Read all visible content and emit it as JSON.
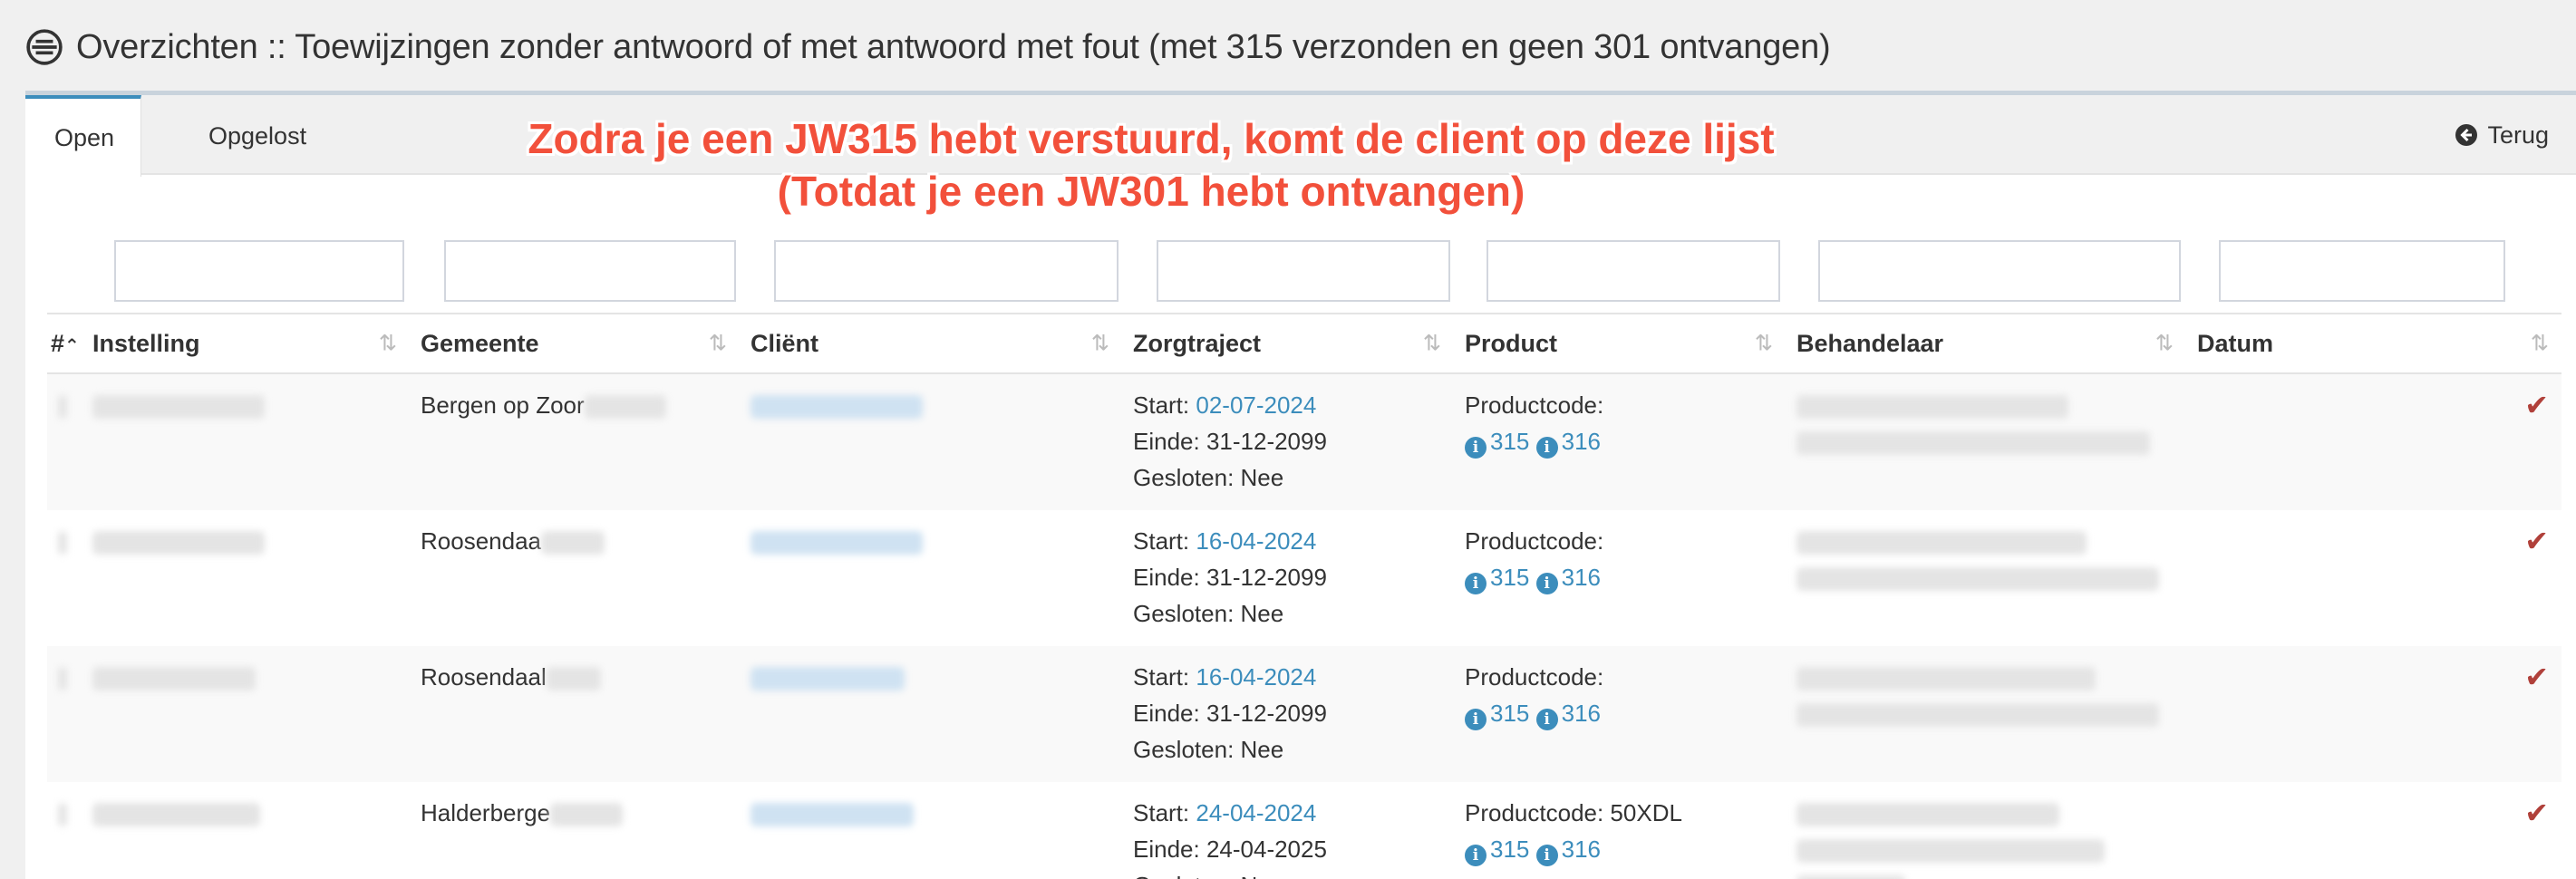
{
  "header": {
    "title": "Overzichten :: Toewijzingen zonder antwoord of met antwoord met fout (met 315 verzonden en geen 301 ontvangen)"
  },
  "tabs": [
    {
      "label": "Open",
      "active": true
    },
    {
      "label": "Opgelost",
      "active": false
    }
  ],
  "back_label": "Terug",
  "annotation": {
    "line1": "Zodra je een JW315 hebt verstuurd, komt de client op deze lijst",
    "line2": "(Totdat je een JW301 hebt ontvangen)"
  },
  "table": {
    "columns": [
      "#",
      "Instelling",
      "Gemeente",
      "Cliënt",
      "Zorgtraject",
      "Product",
      "Behandelaar",
      "Datum"
    ],
    "rows": [
      {
        "gemeente": "Bergen op Zoor",
        "start_label": "Start: ",
        "start": "02-07-2024",
        "einde": "Einde: 31-12-2099",
        "gesloten": "Gesloten: Nee",
        "productcode": "Productcode:",
        "p1": "315",
        "p2": "316"
      },
      {
        "gemeente": "Roosendaa",
        "start_label": "Start: ",
        "start": "16-04-2024",
        "einde": "Einde: 31-12-2099",
        "gesloten": "Gesloten: Nee",
        "productcode": "Productcode:",
        "p1": "315",
        "p2": "316"
      },
      {
        "gemeente": "Roosendaal",
        "start_label": "Start: ",
        "start": "16-04-2024",
        "einde": "Einde: 31-12-2099",
        "gesloten": "Gesloten: Nee",
        "productcode": "Productcode:",
        "p1": "315",
        "p2": "316"
      },
      {
        "gemeente": "Halderberge",
        "start_label": "Start: ",
        "start": "24-04-2024",
        "einde": "Einde: 24-04-2025",
        "gesloten": "Gesloten: Nee",
        "productcode": "Productcode: 50XDL",
        "p1": "315",
        "p2": "316"
      }
    ]
  },
  "colors": {
    "accent": "#3c8dbc",
    "annotation": "#f2503b",
    "check": "#b0403a"
  },
  "icons": {
    "title": "circle-list-icon",
    "back": "circle-arrow-left-icon",
    "sort": "sort-icon",
    "info": "info-circle-icon",
    "done": "check-icon"
  }
}
